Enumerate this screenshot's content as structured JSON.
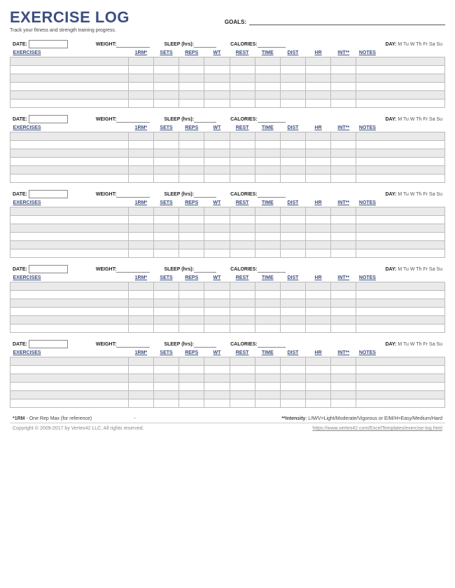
{
  "title": "EXERCISE LOG",
  "subtitle": "Track your fitness and strength training progress.",
  "goals_label": "GOALS:",
  "block": {
    "date_label": "DATE:",
    "weight_label": "WEIGHT:",
    "sleep_label": "SLEEP (hrs):",
    "calories_label": "CALORIES:",
    "day_label": "DAY:",
    "days": "M  Tu  W  Th  Fr  Sa  Su"
  },
  "columns": {
    "exercises": "EXERCISES",
    "rm": "1RM*",
    "sets": "SETS",
    "reps": "REPS",
    "wt": "WT",
    "rest": "REST",
    "time": "TIME",
    "dist": "DIST",
    "hr": "HR",
    "int": "INT**",
    "notes": "NOTES"
  },
  "footnote1_bold": "*1RM",
  "footnote1_rest": " - One Rep Max (for reference)",
  "footnote_mid": "-",
  "footnote2_bold": "**Intensity",
  "footnote2_rest": ": L/M/V=Light/Moderate/Vigorous or E/M/H=Easy/Medium/Hard",
  "copyright": "Copyright © 2009-2017 by Vertex42 LLC. All rights reserved.",
  "url": "https://www.vertex42.com/ExcelTemplates/exercise-log.html"
}
